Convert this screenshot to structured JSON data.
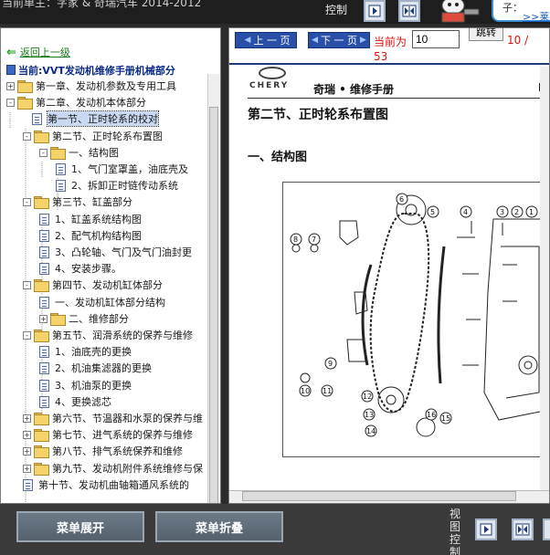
{
  "topbar": {
    "title": "当前单主：字家 & 奇瑞汽车 2014-2012",
    "control_label": "控制",
    "bubble_text": "子：",
    "more_link": ">>莱"
  },
  "tree": {
    "back_label": "返回上一级",
    "current_label": "当前:VVT发动机维修手册机械部分",
    "items": [
      {
        "label": "第一章、发动机参数及专用工具",
        "kind": "folder",
        "exp": "+"
      },
      {
        "label": "第二章、发动机本体部分",
        "kind": "folder",
        "exp": "-"
      },
      {
        "label": "第一节、正时轮系的校对",
        "kind": "doc",
        "selected": true
      },
      {
        "label": "第二节、正时轮系布置图",
        "kind": "folder",
        "exp": "-"
      },
      {
        "label": "一、结构图",
        "kind": "folder",
        "exp": "-"
      },
      {
        "label": "1、气门室罩盖，油底壳及",
        "kind": "doc"
      },
      {
        "label": "2、拆卸正时链传动系统",
        "kind": "doc"
      },
      {
        "label": "第三节、缸盖部分",
        "kind": "folder",
        "exp": "-"
      },
      {
        "label": "1、缸盖系统结构图",
        "kind": "doc"
      },
      {
        "label": "2、配气机构结构图",
        "kind": "doc"
      },
      {
        "label": "3、凸轮轴、气门及气门油封更",
        "kind": "doc"
      },
      {
        "label": "4、安装步骤。",
        "kind": "doc"
      },
      {
        "label": "第四节、发动机缸体部分",
        "kind": "folder",
        "exp": "-"
      },
      {
        "label": "一、发动机缸体部分结构",
        "kind": "doc"
      },
      {
        "label": "二、维修部分",
        "kind": "folder",
        "exp": "+"
      },
      {
        "label": "第五节、润滑系统的保养与维修",
        "kind": "folder",
        "exp": "-"
      },
      {
        "label": "1、油底壳的更换",
        "kind": "doc"
      },
      {
        "label": "2、机油集滤器的更换",
        "kind": "doc"
      },
      {
        "label": "3、机油泵的更换",
        "kind": "doc"
      },
      {
        "label": "4、更换滤芯",
        "kind": "doc"
      },
      {
        "label": "第六节、节温器和水泵的保养与维",
        "kind": "folder",
        "exp": "+"
      },
      {
        "label": "第七节、进气系统的保养与维修",
        "kind": "folder",
        "exp": "+"
      },
      {
        "label": "第八节、排气系统保养和维修",
        "kind": "folder",
        "exp": "+"
      },
      {
        "label": "第九节、发动机附件系统维修与保",
        "kind": "folder",
        "exp": "+"
      },
      {
        "label": "第十节、发动机曲轴箱通风系统的",
        "kind": "doc"
      }
    ]
  },
  "doc": {
    "prev_label": "上 一 页",
    "next_label": "下 一 页",
    "current_prefix": "当前为",
    "page_value": "10",
    "jump_label": "跳转",
    "page_count": "10 /",
    "page_total": "53",
    "brand_name": "CHERY",
    "header_title": "奇瑞 • 维修手册",
    "header_right": "E",
    "section_title": "第二节、正时轮系布置图",
    "subsection_title": "一、结构图",
    "figure_callouts": [
      "1",
      "2",
      "3",
      "4",
      "5",
      "6",
      "7",
      "8",
      "9",
      "10",
      "11",
      "12",
      "13",
      "14",
      "15",
      "16"
    ]
  },
  "bottombar": {
    "expand_label": "菜单展开",
    "collapse_label": "菜单折叠",
    "view_control_label": "视图控制"
  }
}
